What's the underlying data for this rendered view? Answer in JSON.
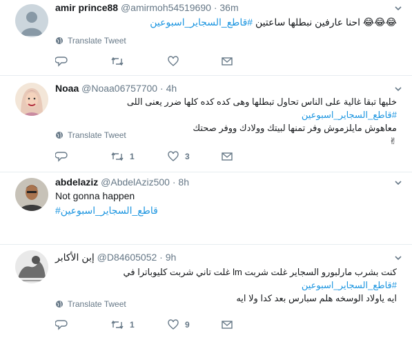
{
  "translate_label": "Translate Tweet",
  "tweets": [
    {
      "name": "amir prince88",
      "handle": "@amirmoh54519690",
      "dot": "·",
      "time": "36m",
      "text_emoji": "😂😂😂",
      "text": "احنا عارفين نبطلها ساعتين",
      "hashtag": "#قاطع_السجاير_اسبوعين",
      "reply_count": "",
      "retweet_count": "",
      "like_count": ""
    },
    {
      "name": "Noaa",
      "handle": "@Noaa06757700",
      "dot": "·",
      "time": "4h",
      "hashtag": "#قاطع_السجاير_اسبوعين",
      "text_line1": "خليها تبقا غالية على الناس تحاول تبطلها وهى كده كده كلها ضرر يعنى اللى",
      "text_line2": "معاهوش مايلزموش وفر تمنها لبيتك وولادك ووفر صحتك",
      "text_emoji": "✌",
      "reply_count": "",
      "retweet_count": "1",
      "like_count": "3"
    },
    {
      "name": "abdelaziz",
      "handle": "@AbdelAziz500",
      "dot": "·",
      "time": "8h",
      "text": "Not gonna happen",
      "hashtag": "#قاطع_السجاير_اسبوعين",
      "reply_count": "",
      "retweet_count": "",
      "like_count": ""
    },
    {
      "name": "إبن الأكابر",
      "handle": "@D84605052",
      "dot": "·",
      "time": "9h",
      "hashtag": "#قاطع_السجاير_اسبوعين",
      "text_line1": "كنت بشرب مارلبورو السجاير غلت شربت lm غلت تاني  شربت كليوباترا في",
      "text_line2": "ايه ياولاد الوسخه هلم سبارس بعد كدا ولا ايه",
      "reply_count": "",
      "retweet_count": "1",
      "like_count": "9"
    }
  ],
  "colors": {
    "hashtag": "#1b95e0",
    "muted": "#657786",
    "divider": "#e6ecf0"
  },
  "icons": [
    "reply-icon",
    "retweet-icon",
    "like-icon",
    "direct-message-icon",
    "globe-icon",
    "caret-down-icon"
  ]
}
